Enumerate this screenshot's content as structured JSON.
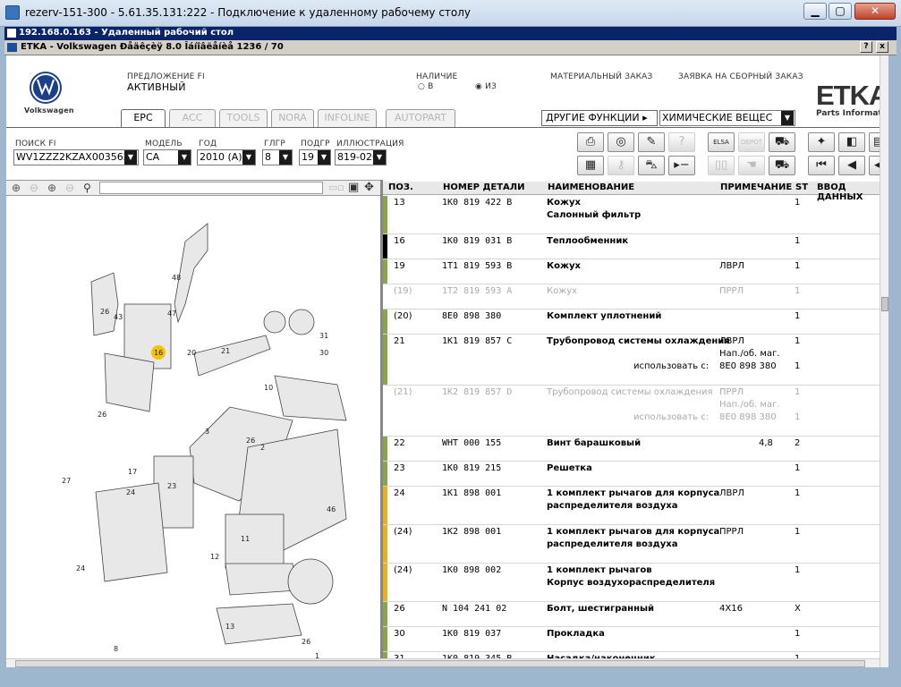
{
  "rdp": {
    "title": "rezerv-151-300 - 5.61.35.131:222 - Подключение к удаленному рабочему столу"
  },
  "remote": {
    "title": "192.168.0.163 - Удаленный рабочий стол"
  },
  "etka": {
    "title": "ETKA - Volkswagen Ðåäêçèÿ 8.0 Îáíîâëåíèå 1236 / 70",
    "help": "?",
    "close": "x"
  },
  "header": {
    "brand": "Volkswagen",
    "offer_label": "ПРЕДЛОЖЕНИЕ FI",
    "offer_value": "АКТИВНЫЙ",
    "stock_label": "НАЛИЧИЕ",
    "stock_in": "В",
    "stock_out": "ИЗ",
    "material_order": "МАТЕРИАЛЬНЫЙ ЗАКАЗ",
    "assembly_order": "ЗАЯВКА НА СБОРНЫЙ ЗАКАЗ",
    "logo_main": "ETKA",
    "logo_sub": "Parts Informati"
  },
  "tabs": [
    "EPC",
    "ACC",
    "TOOLS",
    "NORA",
    "INFOLINE",
    "AUTOPART"
  ],
  "other_functions": "ДРУГИЕ ФУНКЦИИ",
  "chemicals": "ХИМИЧЕСКИЕ ВЕЩЕС",
  "filters": {
    "search_label": "ПОИСК FI",
    "search_value": "WV1ZZZ2KZAX003562",
    "model_label": "МОДЕЛЬ",
    "model_value": "CA",
    "year_label": "ГОД",
    "year_value": "2010 (A)",
    "group_label": "ГЛГР",
    "group_value": "8",
    "subgroup_label": "ПОДГР",
    "subgroup_value": "19",
    "illustration_label": "ИЛЛЮСТРАЦИЯ",
    "illustration_value": "819-020"
  },
  "table": {
    "headers": {
      "pos": "ПОЗ.",
      "num": "НОМЕР ДЕТАЛИ",
      "name": "НАИМЕНОВАНИЕ",
      "note": "ПРИМЕЧАНИЕ",
      "st": "ST",
      "input": "ВВОД ДАННЫХ"
    },
    "rows": [
      {
        "pos": "13",
        "num": "1K0 819 422 B",
        "name": "Кожух",
        "name2": "Салонный фильтр",
        "note": "",
        "st": "1",
        "bar": "#8aa64a"
      },
      {
        "pos": "16",
        "num": "1K0 819 031 B",
        "name": "Теплообменник",
        "name2": "",
        "note": "",
        "st": "1",
        "bar": "#000000"
      },
      {
        "pos": "19",
        "num": "1T1 819 593 B",
        "name": "Кожух",
        "name2": "",
        "note": "ЛВРЛ",
        "st": "1",
        "bar": "#8aa64a"
      },
      {
        "pos": "(19)",
        "num": "1T2 819 593 A",
        "name": "Кожух",
        "name2": "",
        "note": "ПРРЛ",
        "st": "1",
        "bar": "",
        "grey": true
      },
      {
        "pos": "(20)",
        "num": "8E0 898 380",
        "name": "Комплект уплотнений",
        "name2": "",
        "note": "",
        "st": "1",
        "bar": "#8aa64a"
      },
      {
        "pos": "21",
        "num": "1K1 819 857 C",
        "name": "Трубопровод системы охлаждения",
        "name2": "",
        "note": "ЛВРЛ",
        "st": "1",
        "bar": "#8aa64a",
        "sub1": "Нап./об. маг.",
        "sub2_label": "использовать с:",
        "sub2": "8E0 898 380",
        "sub2_st": "1"
      },
      {
        "pos": "(21)",
        "num": "1K2 819 857 D",
        "name": "Трубопровод системы охлаждения",
        "name2": "",
        "note": "ПРРЛ",
        "st": "1",
        "bar": "",
        "grey": true,
        "sub1": "Нап./об. маг.",
        "sub2_label": "использовать с:",
        "sub2": "8E0 898 380",
        "sub2_st": "1"
      },
      {
        "pos": "22",
        "num": "WHT 000 155",
        "name": "Винт барашковый",
        "name2": "",
        "note": "4,8",
        "st": "2",
        "bar": "#8aa64a"
      },
      {
        "pos": "23",
        "num": "1K0 819 215",
        "name": "Решетка",
        "name2": "",
        "note": "",
        "st": "1",
        "bar": "#8aa64a"
      },
      {
        "pos": "24",
        "num": "1K1 898 001",
        "name": "1 комплект рычагов для корпуса",
        "name2": "распределителя воздуха",
        "note": "ЛВРЛ",
        "st": "1",
        "bar": "#e8b020"
      },
      {
        "pos": "(24)",
        "num": "1K2 898 001",
        "name": "1 комплект рычагов для корпуса",
        "name2": "распределителя воздуха",
        "note": "ПРРЛ",
        "st": "1",
        "bar": "#e8b020"
      },
      {
        "pos": "(24)",
        "num": "1K0 898 002",
        "name": "1 комплект рычагов",
        "name2": "Корпус воздухораспределителя",
        "note": "",
        "st": "1",
        "bar": "#e8b020"
      },
      {
        "pos": "26",
        "num": "N  104 241 02",
        "name": "Болт, шестигранный",
        "name2": "",
        "note": "4X16",
        "st": "X",
        "bar": "#8aa64a"
      },
      {
        "pos": "30",
        "num": "1K0 819 037",
        "name": "Прокладка",
        "name2": "",
        "note": "",
        "st": "1",
        "bar": "#8aa64a"
      },
      {
        "pos": "31",
        "num": "1K0 819 345 B",
        "name": "Насадка/наконечник",
        "name2": "",
        "note": "",
        "st": "1",
        "bar": "#8aa64a"
      }
    ]
  },
  "diagram_labels": [
    "48",
    "47",
    "26",
    "43",
    "16",
    "20",
    "21",
    "31",
    "30",
    "26",
    "17",
    "10",
    "3",
    "26",
    "2",
    "27",
    "24",
    "23",
    "46",
    "11",
    "12",
    "24",
    "13",
    "8",
    "19",
    "26",
    "1",
    "26",
    "22"
  ],
  "colors": {
    "selected_callout": "#f5c400"
  }
}
